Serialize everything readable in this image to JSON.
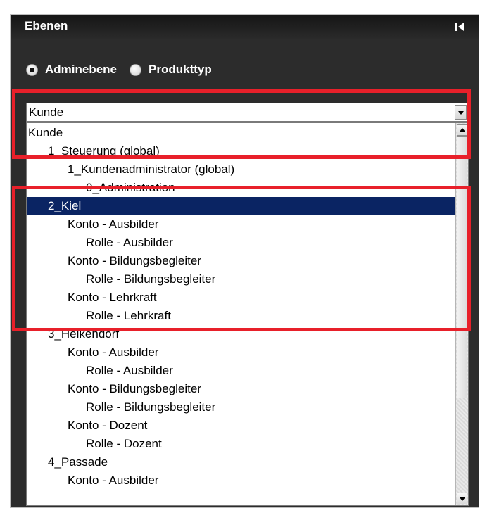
{
  "panel": {
    "title": "Ebenen",
    "collapse_icon": "collapse-left-icon"
  },
  "view_mode": {
    "options": [
      {
        "label": "Adminebene",
        "checked": true
      },
      {
        "label": "Produkttyp",
        "checked": false
      }
    ]
  },
  "dropdown": {
    "value": "Kunde"
  },
  "tree": {
    "items": [
      {
        "label": "Kunde",
        "level": 0,
        "selected": false
      },
      {
        "label": "1_Steuerung (global)",
        "level": 1,
        "selected": false
      },
      {
        "label": "1_Kundenadministrator (global)",
        "level": 2,
        "selected": false
      },
      {
        "label": "0_Administration",
        "level": 3,
        "selected": false
      },
      {
        "label": "2_Kiel",
        "level": 1,
        "selected": true
      },
      {
        "label": "Konto - Ausbilder",
        "level": 2,
        "selected": false
      },
      {
        "label": "Rolle - Ausbilder",
        "level": 3,
        "selected": false
      },
      {
        "label": "Konto - Bildungsbegleiter",
        "level": 2,
        "selected": false
      },
      {
        "label": "Rolle - Bildungsbegleiter",
        "level": 3,
        "selected": false
      },
      {
        "label": "Konto - Lehrkraft",
        "level": 2,
        "selected": false
      },
      {
        "label": "Rolle - Lehrkraft",
        "level": 3,
        "selected": false
      },
      {
        "label": "3_Heikendorf",
        "level": 1,
        "selected": false
      },
      {
        "label": "Konto - Ausbilder",
        "level": 2,
        "selected": false
      },
      {
        "label": "Rolle - Ausbilder",
        "level": 3,
        "selected": false
      },
      {
        "label": "Konto - Bildungsbegleiter",
        "level": 2,
        "selected": false
      },
      {
        "label": "Rolle - Bildungsbegleiter",
        "level": 3,
        "selected": false
      },
      {
        "label": "Konto - Dozent",
        "level": 2,
        "selected": false
      },
      {
        "label": "Rolle - Dozent",
        "level": 3,
        "selected": false
      },
      {
        "label": "4_Passade",
        "level": 1,
        "selected": false
      },
      {
        "label": "Konto - Ausbilder",
        "level": 2,
        "selected": false
      }
    ]
  },
  "colors": {
    "panel_bg": "#2c2c2c",
    "selection": "#0a2463",
    "highlight": "#e8202a"
  }
}
